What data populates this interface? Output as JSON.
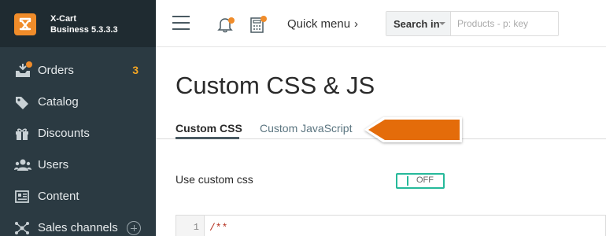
{
  "brand": {
    "line1": "X-Cart",
    "line2": "Business 5.3.3.3"
  },
  "sidebar": {
    "items": [
      {
        "label": "Orders",
        "icon": "orders-icon",
        "count": "3"
      },
      {
        "label": "Catalog",
        "icon": "tag-icon"
      },
      {
        "label": "Discounts",
        "icon": "gift-icon"
      },
      {
        "label": "Users",
        "icon": "users-icon"
      },
      {
        "label": "Content",
        "icon": "content-icon"
      },
      {
        "label": "Sales channels",
        "icon": "sales-channels-icon"
      }
    ]
  },
  "topbar": {
    "quick_menu": "Quick menu",
    "quick_menu_chevron": "›",
    "search_scope": "Search in",
    "search_placeholder": "Products - p: key",
    "search_value": ""
  },
  "main": {
    "title": "Custom CSS & JS",
    "tabs": [
      {
        "label": "Custom CSS",
        "active": true
      },
      {
        "label": "Custom JavaScript",
        "active": false
      }
    ],
    "setting_label": "Use custom css",
    "toggle_state": "OFF",
    "editor": {
      "line_number": "1",
      "code": "/**"
    }
  },
  "colors": {
    "sidebar_bg": "#2b3a42",
    "brand_bg": "#1f2b31",
    "accent_orange": "#f08c2a",
    "callout_orange": "#e46c0a",
    "toggle_green": "#26b99a",
    "count_color": "#f5a623"
  }
}
